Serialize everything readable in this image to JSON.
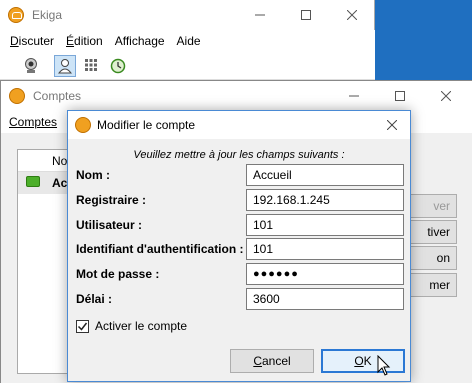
{
  "main_window": {
    "title": "Ekiga",
    "menus": [
      {
        "label": "Discuter",
        "u": "D",
        "rest": "iscuter"
      },
      {
        "label": "Édition",
        "u": "É",
        "rest": "dition"
      },
      {
        "label": "Affichage",
        "u": "",
        "rest": "Affichage"
      },
      {
        "label": "Aide",
        "u": "",
        "rest": "Aide"
      }
    ],
    "toolbar_icons": [
      "webcam-icon",
      "contact-icon",
      "dialpad-icon",
      "history-icon"
    ]
  },
  "accounts_window": {
    "title": "Comptes",
    "menu": "Comptes",
    "list": {
      "column_header": "No",
      "row_name": "Ac"
    },
    "side_buttons": [
      "ver",
      "tiver",
      "on",
      "mer"
    ]
  },
  "dialog": {
    "title": "Modifier le compte",
    "instruction": "Veuillez mettre à jour les champs suivants :",
    "fields": [
      {
        "label": "Nom :",
        "value": "Accueil"
      },
      {
        "label": "Registraire :",
        "value": "192.168.1.245"
      },
      {
        "label": "Utilisateur :",
        "value": "101"
      },
      {
        "label": "Identifiant d'authentification :",
        "value": "101"
      },
      {
        "label": "Mot de passe :",
        "value": "●●●●●●"
      },
      {
        "label": "Délai :",
        "value": "3600"
      }
    ],
    "checkbox_label": "Activer le compte",
    "checkbox_checked": true,
    "cancel": {
      "u": "C",
      "rest": "ancel"
    },
    "ok": {
      "u": "O",
      "rest": "K"
    }
  },
  "colors": {
    "accent": "#2b78d4",
    "desktop": "#1f6fc0"
  }
}
